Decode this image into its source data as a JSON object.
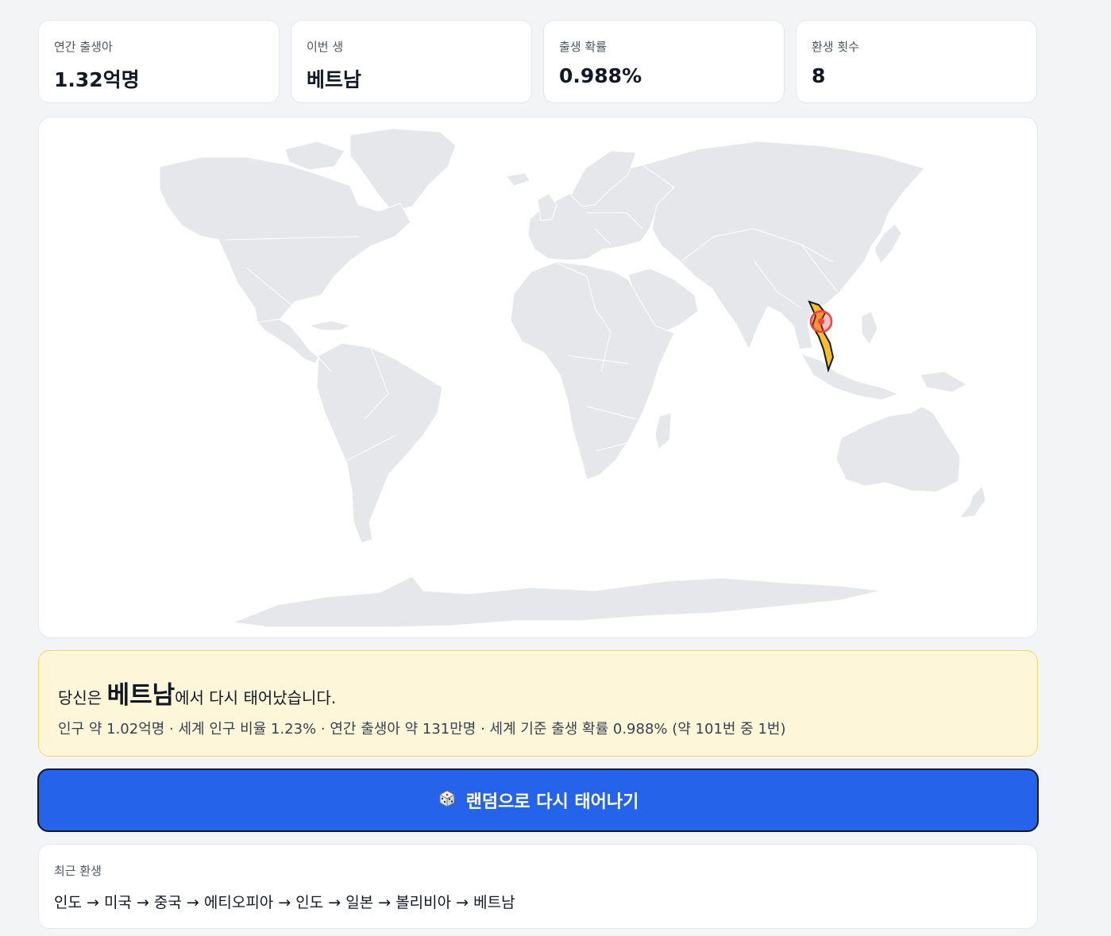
{
  "stats": [
    {
      "label": "연간 출생아",
      "value": "1.32억명"
    },
    {
      "label": "이번 생",
      "value": "베트남"
    },
    {
      "label": "출생 확률",
      "value": "0.988%"
    },
    {
      "label": "환생 횟수",
      "value": "8"
    }
  ],
  "map": {
    "highlight_country": "베트남",
    "land_color": "#e5e7eb",
    "highlight_color": "#fbbf24",
    "marker_color": "#ef4444"
  },
  "result": {
    "prefix": "당신은 ",
    "country": "베트남",
    "suffix": "에서 다시 태어났습니다.",
    "details": "인구 약 1.02억명 · 세계 인구 비율 1.23% · 연간 출생아 약 131만명 · 세계 기준 출생 확률 0.988% (약 101번 중 1번)"
  },
  "reroll_button": {
    "icon": "dice-icon",
    "label": "랜덤으로 다시 태어나기"
  },
  "history": {
    "label": "최근 환생",
    "path": "인도 → 미국 → 중국 → 에티오피아 → 인도 → 일본 → 볼리비아 → 베트남"
  },
  "colors": {
    "accent": "#2563eb",
    "result_bg": "#fef6d8",
    "page_bg": "#f3f4f6"
  }
}
